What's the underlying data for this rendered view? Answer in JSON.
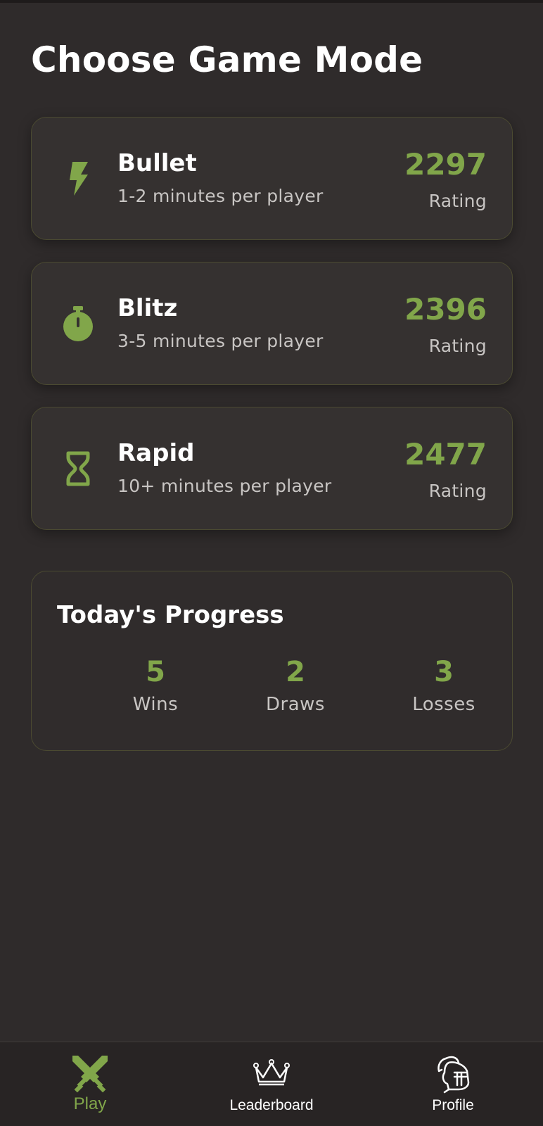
{
  "title": "Choose Game Mode",
  "accent_color": "#81a64a",
  "modes": [
    {
      "name": "Bullet",
      "description": "1-2 minutes per player",
      "rating": "2297",
      "rating_label": "Rating",
      "icon": "lightning-bolt-icon"
    },
    {
      "name": "Blitz",
      "description": "3-5 minutes per player",
      "rating": "2396",
      "rating_label": "Rating",
      "icon": "stopwatch-icon"
    },
    {
      "name": "Rapid",
      "description": "10+ minutes per player",
      "rating": "2477",
      "rating_label": "Rating",
      "icon": "hourglass-icon"
    }
  ],
  "progress": {
    "title": "Today's Progress",
    "stats": [
      {
        "value": "5",
        "label": "Wins"
      },
      {
        "value": "2",
        "label": "Draws"
      },
      {
        "value": "3",
        "label": "Losses"
      }
    ]
  },
  "nav": {
    "items": [
      {
        "label": "Play",
        "icon": "crossed-swords-icon",
        "active": true
      },
      {
        "label": "Leaderboard",
        "icon": "crown-icon",
        "active": false
      },
      {
        "label": "Profile",
        "icon": "knight-helmet-icon",
        "active": false
      }
    ]
  }
}
